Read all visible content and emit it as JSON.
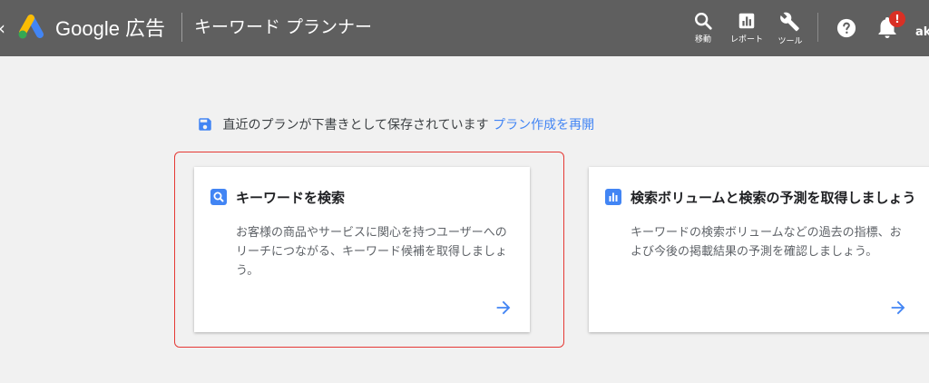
{
  "header": {
    "product_name": "Google 広告",
    "page_title": "キーワード プランナー",
    "tools": [
      {
        "label": "移動",
        "icon": "search-icon"
      },
      {
        "label": "レポート",
        "icon": "report-icon"
      },
      {
        "label": "ツール",
        "icon": "wrench-icon"
      }
    ],
    "notification_badge": "!",
    "account_label": "aki"
  },
  "draft": {
    "message": "直近のプランが下書きとして保存されています",
    "resume_link": "プラン作成を再開"
  },
  "cards": [
    {
      "title": "キーワードを検索",
      "description": "お客様の商品やサービスに関心を持つユーザーへのリーチにつながる、キーワード候補を取得しましょう。",
      "icon": "search-icon"
    },
    {
      "title": "検索ボリュームと検索の予測を取得しましょう",
      "description": "キーワードの検索ボリュームなどの過去の指標、および今後の掲載結果の予測を確認しましょう。",
      "icon": "bar-chart-icon"
    }
  ],
  "colors": {
    "header_bg": "#5f5f5f",
    "accent": "#4285f4",
    "highlight": "#e53935",
    "badge": "#d93025"
  }
}
